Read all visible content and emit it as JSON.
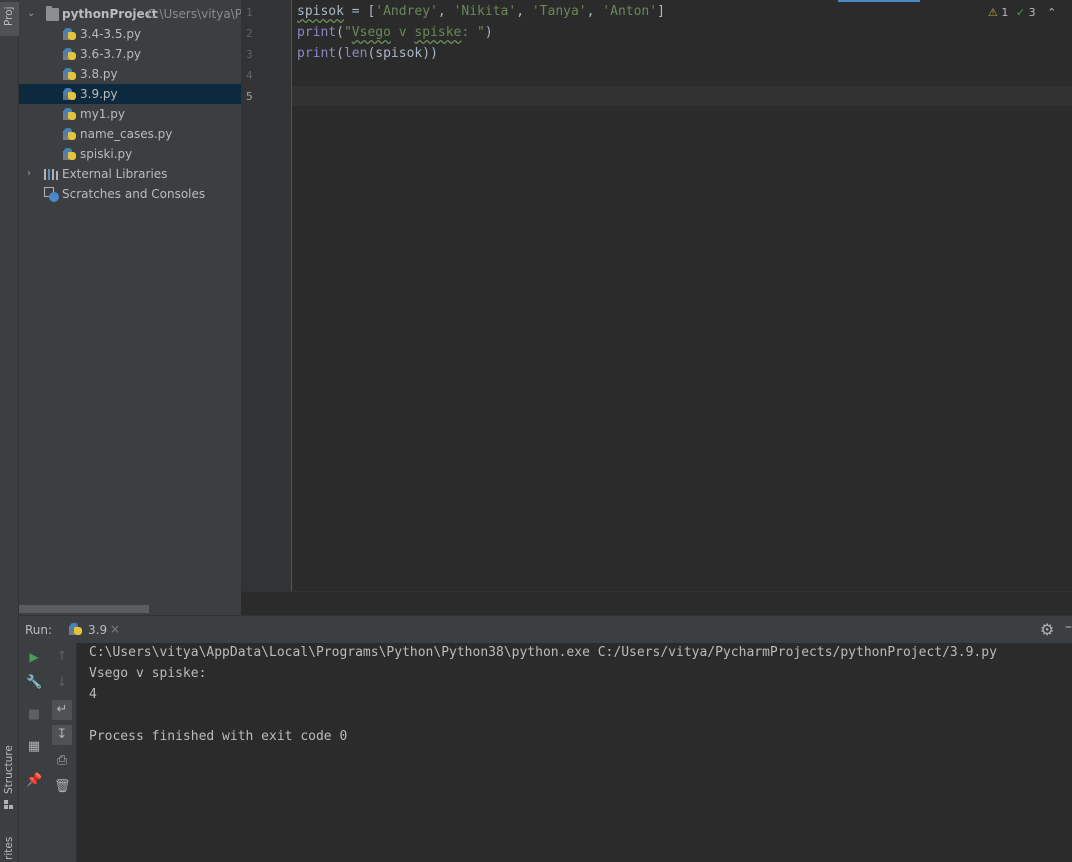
{
  "left_stripe": {
    "project_tab": "Proj",
    "structure_tab": "Structure",
    "favorites_tab": "rites"
  },
  "project_tree": {
    "root": {
      "name": "pythonProject",
      "path": "C:\\Users\\vitya\\Pyc"
    },
    "files": [
      {
        "name": "3.4-3.5.py",
        "selected": false
      },
      {
        "name": "3.6-3.7.py",
        "selected": false
      },
      {
        "name": "3.8.py",
        "selected": false
      },
      {
        "name": "3.9.py",
        "selected": true
      },
      {
        "name": "my1.py",
        "selected": false
      },
      {
        "name": "name_cases.py",
        "selected": false
      },
      {
        "name": "spiski.py",
        "selected": false
      }
    ],
    "external_libraries": "External Libraries",
    "scratches": "Scratches and Consoles"
  },
  "editor": {
    "line_numbers": [
      "1",
      "2",
      "3",
      "4",
      "5"
    ],
    "current_line": "5",
    "code": {
      "l1_var": "spisok",
      "l1_eq": " = [",
      "l1_s1": "'Andrey'",
      "l1_c1": ", ",
      "l1_s2": "'Nikita'",
      "l1_c2": ", ",
      "l1_s3": "'Tanya'",
      "l1_c3": ", ",
      "l1_s4": "'Anton'",
      "l1_end": "]",
      "l2_fn": "print",
      "l2_open": "(",
      "l2_q": "\"",
      "l2_w1": "Vsego",
      "l2_sp1": " v ",
      "l2_w2": "spiske",
      "l2_rest": ": \"",
      "l2_close": ")",
      "l3_fn": "print",
      "l3_open": "(",
      "l3_fn2": "len",
      "l3_rest": "(spisok))"
    },
    "inspections": {
      "warnings": "1",
      "ok": "3"
    }
  },
  "run_panel": {
    "label": "Run:",
    "tab": "3.9",
    "console": [
      "C:\\Users\\vitya\\AppData\\Local\\Programs\\Python\\Python38\\python.exe C:/Users/vitya/PycharmProjects/pythonProject/3.9.py",
      "Vsego v spiske:",
      "4",
      "",
      "Process finished with exit code 0"
    ]
  },
  "colors": {
    "accent": "#4a88c7",
    "string": "#6a8759",
    "builtin": "#8888c6",
    "run_green": "#499c54"
  }
}
